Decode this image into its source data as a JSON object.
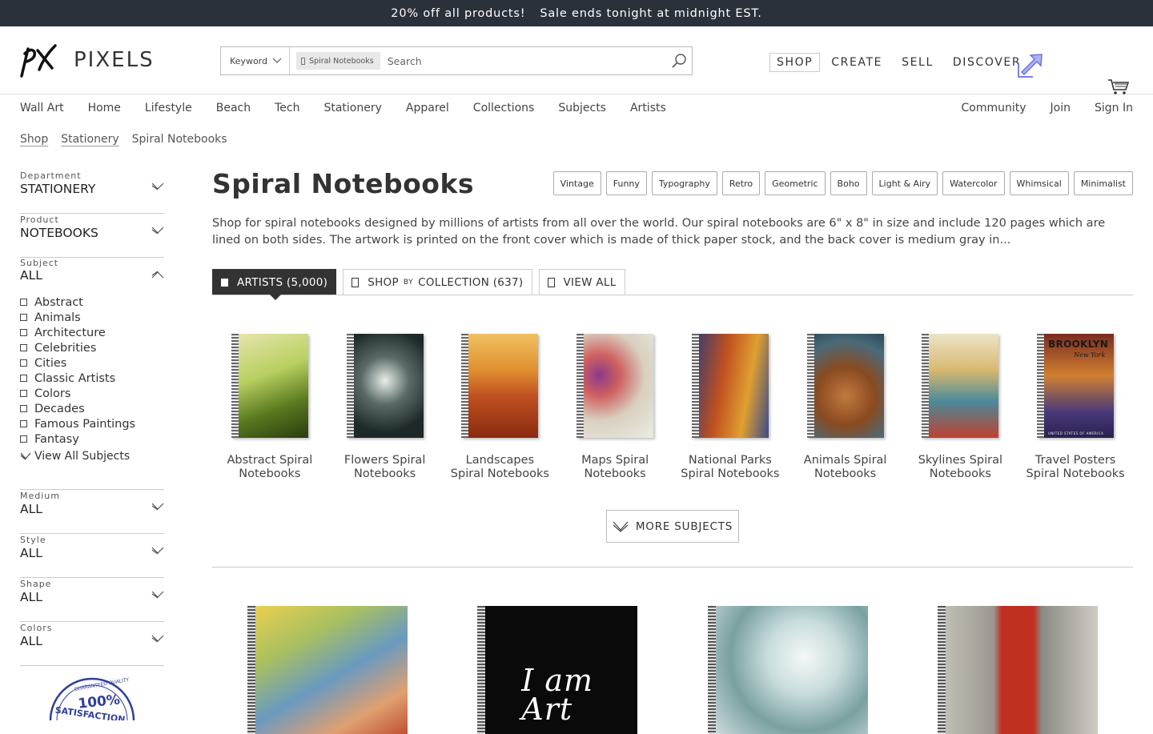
{
  "banner": {
    "offer": "20% off all products!",
    "deadline": "Sale ends tonight at midnight EST."
  },
  "header": {
    "logo_text": "PIXELS",
    "search": {
      "mode": "Keyword",
      "chip": "Spiral Notebooks",
      "placeholder": "Search"
    },
    "nav": [
      {
        "label": "SHOP"
      },
      {
        "label": "CREATE"
      },
      {
        "label": "SELL"
      },
      {
        "label": "DISCOVER"
      }
    ]
  },
  "catnav": {
    "items": [
      "Wall Art",
      "Home",
      "Lifestyle",
      "Beach",
      "Tech",
      "Stationery",
      "Apparel",
      "Collections",
      "Subjects",
      "Artists"
    ],
    "right": [
      "Community",
      "Join",
      "Sign In"
    ]
  },
  "breadcrumb": {
    "shop": "Shop",
    "stationery": "Stationery",
    "current": "Spiral Notebooks"
  },
  "sidebar": {
    "department": {
      "label": "Department",
      "value": "STATIONERY"
    },
    "product": {
      "label": "Product",
      "value": "NOTEBOOKS"
    },
    "subject": {
      "label": "Subject",
      "value": "ALL",
      "options": [
        "Abstract",
        "Animals",
        "Architecture",
        "Celebrities",
        "Cities",
        "Classic Artists",
        "Colors",
        "Decades",
        "Famous Paintings",
        "Fantasy"
      ],
      "view_all": "View All Subjects"
    },
    "medium": {
      "label": "Medium",
      "value": "ALL"
    },
    "style": {
      "label": "Style",
      "value": "ALL"
    },
    "shape": {
      "label": "Shape",
      "value": "ALL"
    },
    "colors": {
      "label": "Colors",
      "value": "ALL"
    },
    "badge_text": "100%",
    "badge_ring": "GUARANTEED QUALITY",
    "badge_sub": "SATISFACTION"
  },
  "main": {
    "title": "Spiral Notebooks",
    "tags": [
      "Vintage",
      "Funny",
      "Typography",
      "Retro",
      "Geometric",
      "Boho",
      "Light & Airy",
      "Watercolor",
      "Whimsical",
      "Minimalist"
    ],
    "description": "Shop for spiral notebooks designed by millions of artists from all over the world.   Our spiral notebooks are 6\" x 8\" in size and include 120 pages which are lined on both sides.   The artwork is printed on the front cover which is made of thick paper stock, and the back cover is medium gray in...",
    "tabs": {
      "artists": "ARTISTS (5,000)",
      "collection_pre": "SHOP",
      "collection_by": "BY",
      "collection_post": "COLLECTION (637)",
      "view_all": "VIEW ALL"
    },
    "subjects": [
      {
        "line1": "Abstract Spiral",
        "line2": "Notebooks"
      },
      {
        "line1": "Flowers Spiral",
        "line2": "Notebooks"
      },
      {
        "line1": "Landscapes",
        "line2": "Spiral Notebooks"
      },
      {
        "line1": "Maps Spiral",
        "line2": "Notebooks"
      },
      {
        "line1": "National Parks",
        "line2": "Spiral Notebooks"
      },
      {
        "line1": "Animals Spiral",
        "line2": "Notebooks"
      },
      {
        "line1": "Skylines Spiral",
        "line2": "Notebooks"
      },
      {
        "line1": "Travel Posters",
        "line2": "Spiral Notebooks"
      }
    ],
    "more_subjects": "MORE SUBJECTS",
    "poster_text": {
      "title": "BROOKLYN",
      "subtitle": "New York",
      "caption": "UNITED STATES OF AMERICA"
    },
    "product_art_text": {
      "line1": "I am",
      "line2": "Art"
    }
  }
}
